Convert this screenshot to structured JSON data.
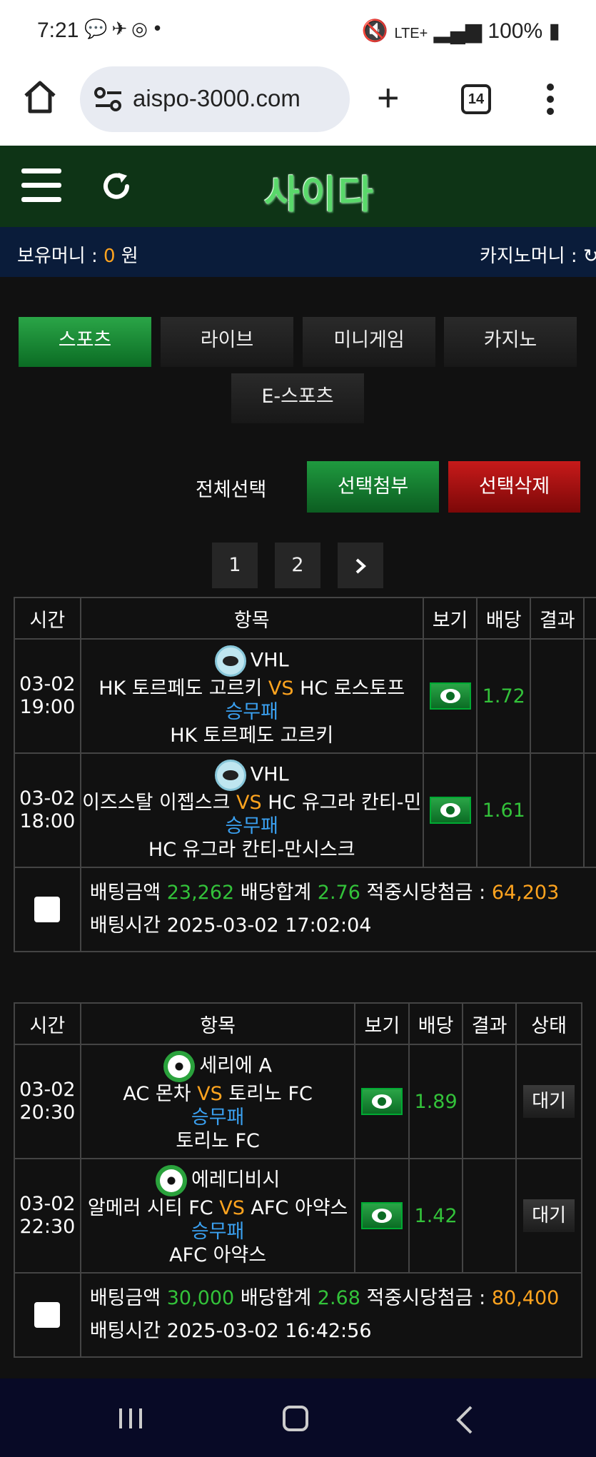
{
  "status_bar": {
    "time": "7:21",
    "network": "LTE+",
    "battery": "100%"
  },
  "browser": {
    "url": "aispo-3000.com",
    "tab_count": "14"
  },
  "site": {
    "logo_text": "사이다"
  },
  "money_bar": {
    "holding_label": "보유머니 :",
    "holding_value": "0",
    "holding_unit": "원",
    "casino_label": "카지노머니 :"
  },
  "categories": [
    "스포츠",
    "라이브",
    "미니게임",
    "카지노",
    "E-스포츠"
  ],
  "actions": {
    "select_all": "전체선택",
    "attach_selected": "선택첨부",
    "delete_selected": "선택삭제"
  },
  "pagination": {
    "pages": [
      "1",
      "2"
    ],
    "next": "›"
  },
  "bet_slips": [
    {
      "headers": [
        "시간",
        "항목",
        "보기",
        "배당",
        "결과"
      ],
      "rows": [
        {
          "date": "03-02",
          "time": "19:00",
          "icon": "hockey-icon",
          "league": "VHL",
          "home": "HK 토르페도 고르키",
          "vs": "VS",
          "away": "HC 로스토프",
          "market": "승무패",
          "pick": "HK 토르페도 고르키",
          "odds": "1.72"
        },
        {
          "date": "03-02",
          "time": "18:00",
          "icon": "hockey-icon",
          "league": "VHL",
          "home": "이즈스탈 이젭스크",
          "vs": "VS",
          "away": "HC 유그라 칸티-민",
          "market": "승무패",
          "pick": "HC 유그라 칸티-만시스크",
          "odds": "1.61"
        }
      ],
      "summary": {
        "amount_label": "배팅금액",
        "amount": "23,262",
        "total_odds_label": "배당합계",
        "total_odds": "2.76",
        "payout_label": "적중시당첨금 :",
        "payout": "64,203",
        "time_label": "배팅시간",
        "time": "2025-03-02 17:02:04"
      }
    },
    {
      "headers": [
        "시간",
        "항목",
        "보기",
        "배당",
        "결과",
        "상태"
      ],
      "rows": [
        {
          "date": "03-02",
          "time": "20:30",
          "icon": "soccer-icon",
          "league": "세리에 A",
          "home": "AC 몬차",
          "vs": "VS",
          "away": "토리노 FC",
          "market": "승무패",
          "pick": "토리노 FC",
          "odds": "1.89",
          "status": "대기"
        },
        {
          "date": "03-02",
          "time": "22:30",
          "icon": "soccer-icon",
          "league": "에레디비시",
          "home": "알메러 시티 FC",
          "vs": "VS",
          "away": "AFC 아약스",
          "market": "승무패",
          "pick": "AFC 아약스",
          "odds": "1.42",
          "status": "대기"
        }
      ],
      "summary": {
        "amount_label": "배팅금액",
        "amount": "30,000",
        "total_odds_label": "배당합계",
        "total_odds": "2.68",
        "payout_label": "적중시당첨금 :",
        "payout": "80,400",
        "time_label": "배팅시간",
        "time": "2025-03-02 16:42:56"
      }
    }
  ],
  "colors": {
    "accent_green": "#1f9a3f",
    "danger_red": "#c71a1a",
    "highlight_orange": "#ffa41f",
    "market_blue": "#3aa0f0",
    "header_bg": "#0e3416",
    "money_bar_bg": "#0a1c3a"
  }
}
